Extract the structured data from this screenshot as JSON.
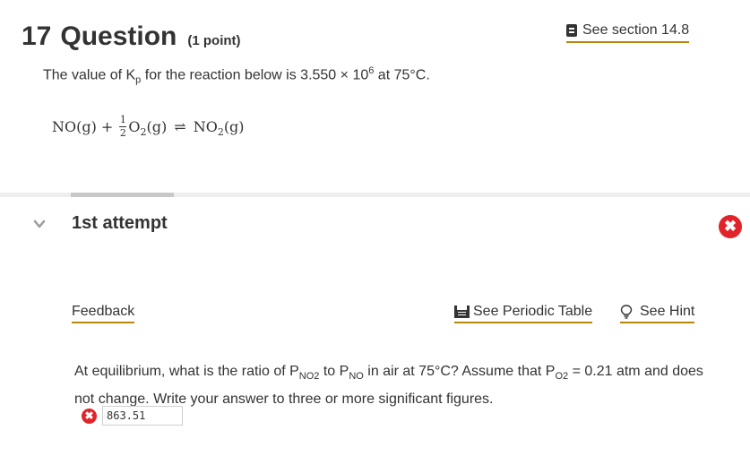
{
  "question": {
    "number": "17",
    "word": "Question",
    "points": "(1 point)"
  },
  "see_section": {
    "label": "See section 14.8",
    "icon": "book-icon"
  },
  "kp_statement": {
    "part1": "The value of K",
    "subscript": "p",
    "part2": " for the reaction below is 3.550 × 10",
    "exponent": "6",
    "part3": " at 75°C."
  },
  "equation": {
    "reactant1": "NO(g) + ",
    "frac_num": "1",
    "frac_den": "2",
    "reactant2_pre": "O",
    "reactant2_sub": "2",
    "reactant2_post": "(g)",
    "arrow": "⇌",
    "product_pre": "NO",
    "product_sub": "2",
    "product_post": "(g)"
  },
  "attempt": {
    "title": "1st attempt",
    "status_icon": "error-icon",
    "status_symbol": "✖"
  },
  "links": {
    "feedback": "Feedback",
    "periodic_table": "See Periodic Table",
    "hint": "See Hint"
  },
  "prompt": {
    "t1": "At equilibrium, what is the ratio of P",
    "s1": "NO2",
    "t2": " to P",
    "s2": "NO",
    "t3": " in air at 75°C? Assume that P",
    "s3": "O2",
    "t4": " = 0.21 atm and does not change. Write your answer to three or more significant figures."
  },
  "answer": {
    "value": "863.51",
    "status_symbol": "✖"
  },
  "colors": {
    "link_underline": "#b8860b",
    "error": "#e0242a"
  }
}
